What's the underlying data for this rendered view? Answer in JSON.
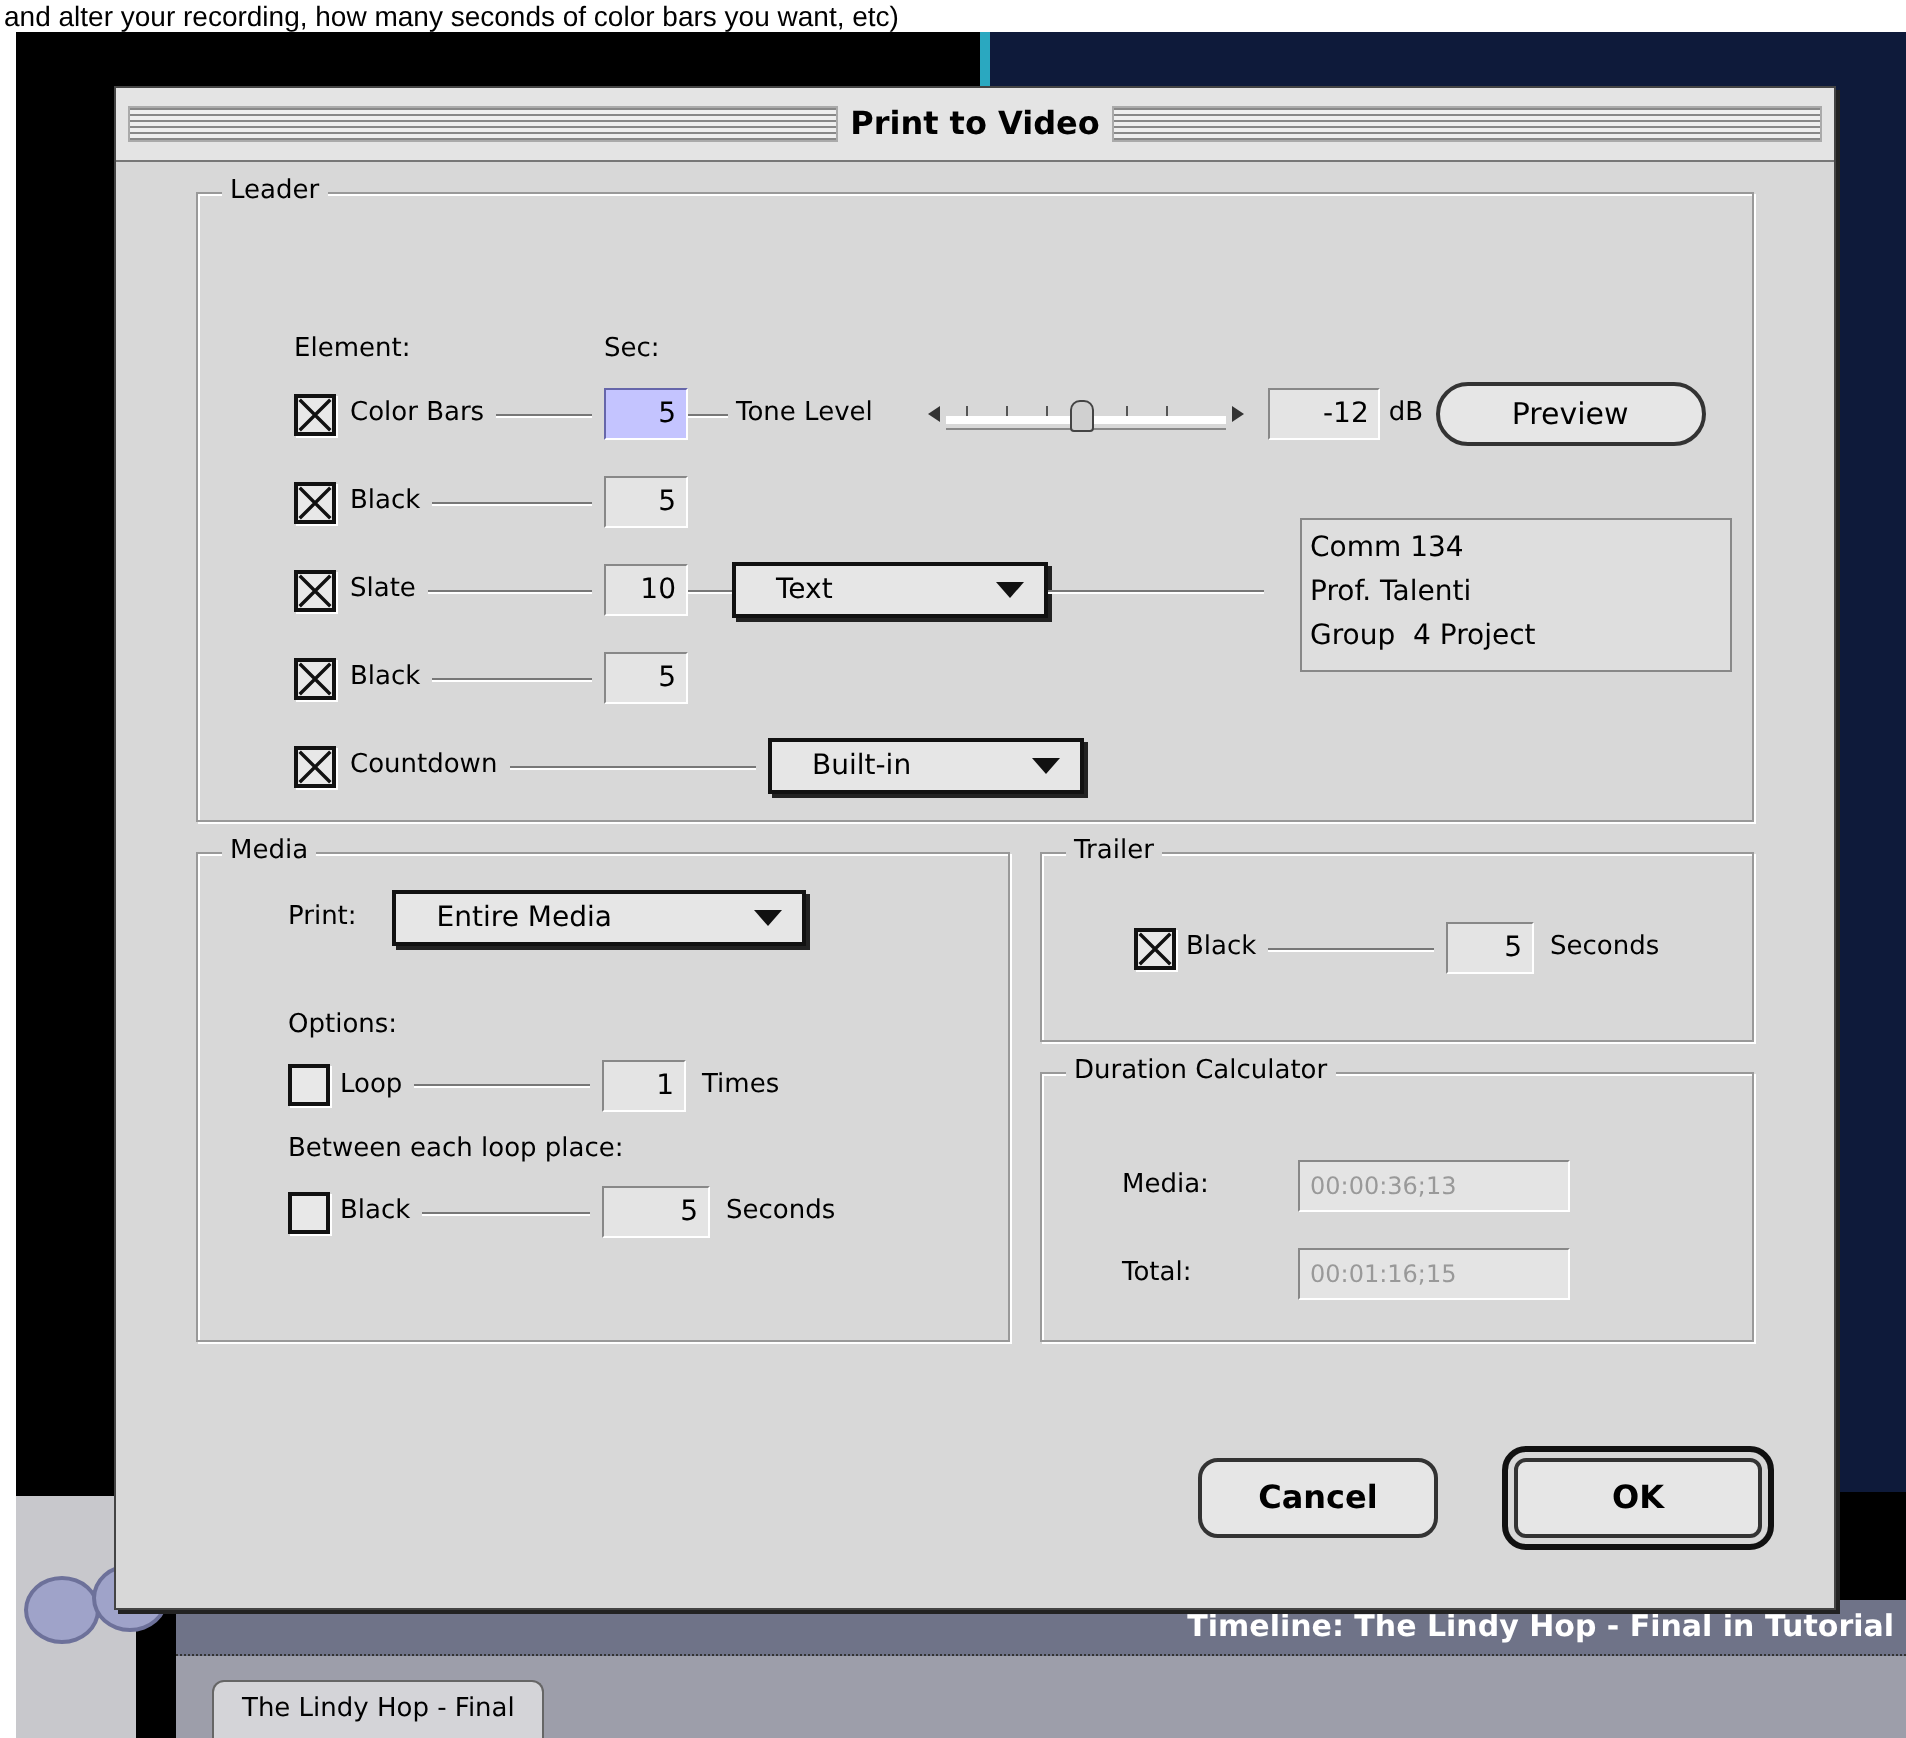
{
  "caption": "and alter your recording, how many seconds of color bars you want, etc)",
  "dialog": {
    "title": "Print to Video",
    "leader": {
      "title": "Leader",
      "element_header": "Element:",
      "sec_header": "Sec:",
      "rows": [
        {
          "kind": "color_bars",
          "label": "Color Bars",
          "checked": true,
          "seconds": "5",
          "focused": true,
          "tone_label": "Tone Level",
          "level": 0.48,
          "reading": "-12",
          "unit": "dB",
          "button": "Preview"
        },
        {
          "kind": "plain",
          "label": "Black",
          "checked": true,
          "seconds": "5",
          "focused": false
        },
        {
          "kind": "slate",
          "label": "Slate",
          "checked": true,
          "seconds": "10",
          "focused": false,
          "popup": "Text",
          "slate_text": [
            "Comm 134",
            "Prof. Talenti",
            "Group  4 Project"
          ]
        },
        {
          "kind": "plain",
          "label": "Black",
          "checked": true,
          "seconds": "5",
          "focused": false
        },
        {
          "kind": "countdown",
          "label": "Countdown",
          "checked": true,
          "popup": "Built-in"
        }
      ]
    },
    "media": {
      "title": "Media",
      "print_label": "Print:",
      "print_value": "Entire Media",
      "options_label": "Options:",
      "loop": {
        "label": "Loop",
        "checked": false,
        "value": "1",
        "unit": "Times"
      },
      "between_label": "Between each loop place:",
      "black": {
        "label": "Black",
        "checked": false,
        "value": "5",
        "unit": "Seconds"
      }
    },
    "trailer": {
      "title": "Trailer",
      "black": {
        "label": "Black",
        "checked": true,
        "value": "5",
        "unit": "Seconds"
      }
    },
    "duration": {
      "title": "Duration Calculator",
      "rows": [
        {
          "label": "Media:",
          "value": "00:00:36;13",
          "disabled": true
        },
        {
          "label": "Total:",
          "value": "00:01:16;15",
          "disabled": true
        }
      ]
    },
    "buttons": [
      {
        "label": "Cancel",
        "default": false
      },
      {
        "label": "OK",
        "default": true
      }
    ]
  },
  "timeline": {
    "title": "Timeline: The Lindy Hop - Final in Tutorial",
    "tabs": [
      {
        "label": "The Lindy Hop - Final",
        "selected": true
      }
    ]
  }
}
